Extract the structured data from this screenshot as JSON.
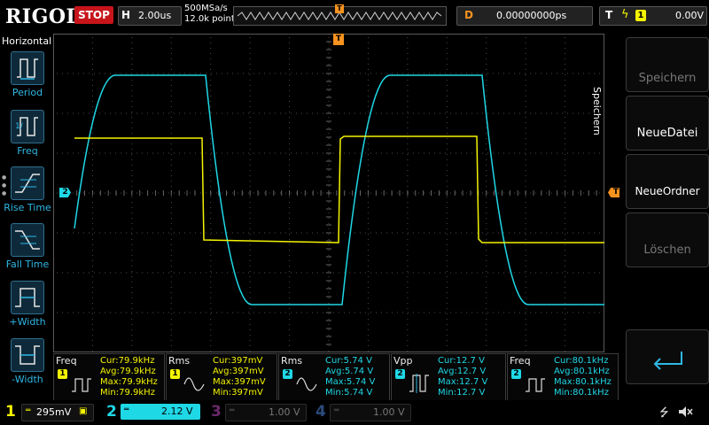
{
  "topbar": {
    "brand": "RIGOL",
    "run_state": "STOP",
    "timebase_key": "H",
    "timebase_value": "2.00us",
    "sample_rate": "500MSa/s",
    "memory_depth": "12.0k points",
    "delay_key": "D",
    "delay_value": "0.00000000ps",
    "trigger_key": "T",
    "trigger_source": "1",
    "trigger_level": "0.00V"
  },
  "left_menu": {
    "title": "Horizontal",
    "items": [
      {
        "label": "Period",
        "icon": "period-icon"
      },
      {
        "label": "Freq",
        "icon": "freq-icon"
      },
      {
        "label": "Rise Time",
        "icon": "rise-time-icon"
      },
      {
        "label": "Fall Time",
        "icon": "fall-time-icon"
      },
      {
        "label": "+Width",
        "icon": "positive-width-icon"
      },
      {
        "label": "-Width",
        "icon": "negative-width-icon"
      }
    ]
  },
  "right_menu": {
    "title": "Speichern",
    "buttons": [
      {
        "label": "Speichern",
        "enabled": false
      },
      {
        "label": "NeueDatei",
        "enabled": true
      },
      {
        "label": "NeueOrdner",
        "enabled": true
      },
      {
        "label": "Löschen",
        "enabled": false
      },
      {
        "label": "",
        "enabled": true,
        "icon": "return-arrow-icon"
      }
    ]
  },
  "markers": {
    "trigger_top": "T",
    "ch2_ref": "2",
    "trigger_level_marker": "T"
  },
  "colors": {
    "ch1": "#f4f400",
    "ch2": "#1fd8e6",
    "ch3": "#cc33cc",
    "ch4": "#3e7bd6",
    "trigger": "#f7931e",
    "menu_label": "#2fb8e6"
  },
  "measurements": [
    {
      "name": "Freq",
      "channel": "1",
      "cur": "Cur:79.9kHz",
      "avg": "Avg:79.9kHz",
      "max": "Max:79.9kHz",
      "min": "Min:79.9kHz"
    },
    {
      "name": "Rms",
      "channel": "1",
      "cur": "Cur:397mV",
      "avg": "Avg:397mV",
      "max": "Max:397mV",
      "min": "Min:397mV"
    },
    {
      "name": "Rms",
      "channel": "2",
      "cur": "Cur:5.74 V",
      "avg": "Avg:5.74 V",
      "max": "Max:5.74 V",
      "min": "Min:5.74 V"
    },
    {
      "name": "Vpp",
      "channel": "2",
      "cur": "Cur:12.7 V",
      "avg": "Avg:12.7 V",
      "max": "Max:12.7 V",
      "min": "Min:12.7 V"
    },
    {
      "name": "Freq",
      "channel": "2",
      "cur": "Cur:80.1kHz",
      "avg": "Avg:80.1kHz",
      "max": "Max:80.1kHz",
      "min": "Min:80.1kHz"
    }
  ],
  "channels": [
    {
      "num": "1",
      "scale": "295mV",
      "active": true
    },
    {
      "num": "2",
      "scale": "2.12 V",
      "active": true
    },
    {
      "num": "3",
      "scale": "1.00 V",
      "active": false
    },
    {
      "num": "4",
      "scale": "1.00 V",
      "active": false
    }
  ]
}
